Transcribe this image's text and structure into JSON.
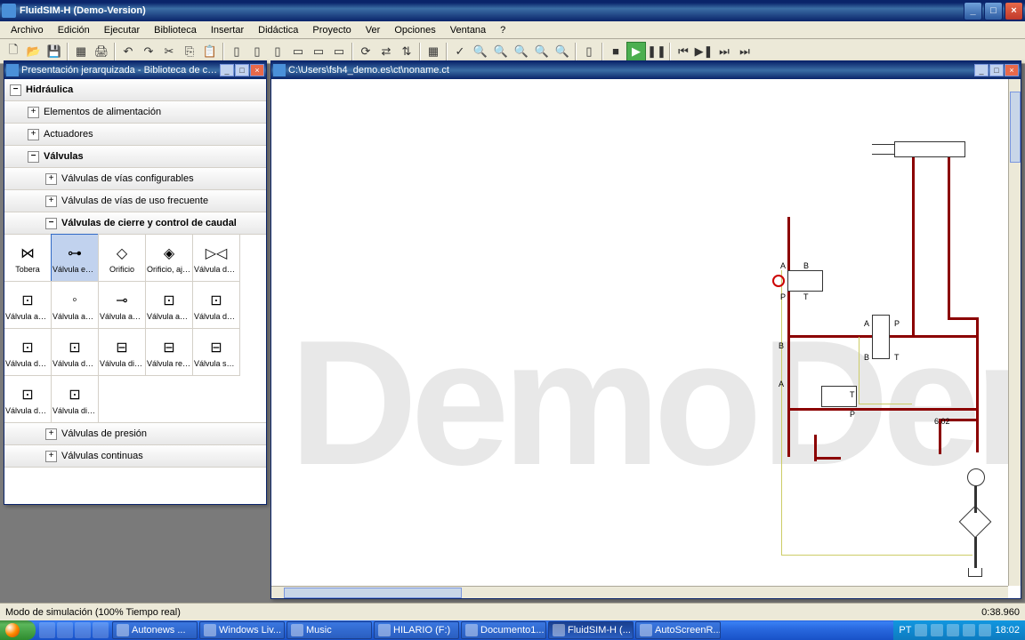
{
  "app": {
    "title": "FluidSIM-H (Demo-Version)"
  },
  "menu": [
    "Archivo",
    "Edición",
    "Ejecutar",
    "Biblioteca",
    "Insertar",
    "Didáctica",
    "Proyecto",
    "Ver",
    "Opciones",
    "Ventana",
    "?"
  ],
  "library": {
    "title": "Presentación jerarquizada - Biblioteca de co...",
    "root": "Hidráulica",
    "items": [
      {
        "label": "Elementos de alimentación",
        "level": 1,
        "exp": "+"
      },
      {
        "label": "Actuadores",
        "level": 1,
        "exp": "+"
      },
      {
        "label": "Válvulas",
        "level": 1,
        "exp": "−",
        "bold": true
      },
      {
        "label": "Válvulas de vías configurables",
        "level": 2,
        "exp": "+"
      },
      {
        "label": "Válvulas de vías de uso frecuente",
        "level": 2,
        "exp": "+"
      },
      {
        "label": "Válvulas de cierre y control de caudal",
        "level": 2,
        "exp": "−",
        "bold": true
      },
      {
        "label": "Válvulas de presión",
        "level": 2,
        "exp": "+",
        "after_grid": true
      },
      {
        "label": "Válvulas continuas",
        "level": 2,
        "exp": "+",
        "after_grid": true
      }
    ],
    "symbols_row1": [
      "Tobera",
      "Válvula estr...",
      "Orificio",
      "Orificio, aju...",
      "Válvula de ..."
    ],
    "symbols_row2": [
      "Válvula anti...",
      "Válvula anti...",
      "Válvula anti...",
      "Válvula anti...",
      "Válvula de r..."
    ],
    "symbols_row3": [
      "Válvula de r...",
      "Válvula de r...",
      "Válvula dire...",
      "Válvula reg...",
      "Válvula sele..."
    ],
    "symbols_row4": [
      "Válvula de ...",
      "Válvula dist..."
    ]
  },
  "circuit": {
    "title": "C:\\Users\\fsh4_demo.es\\ct\\noname.ct",
    "ports": {
      "a": "A",
      "b": "B",
      "p": "P",
      "t": "T"
    },
    "gauge": "6.02"
  },
  "status": {
    "left": "Modo de simulación (100% Tiempo real)",
    "right": "0:38.960"
  },
  "taskbar": {
    "items": [
      "Autonews ...",
      "Windows Liv...",
      "Music",
      "HILARIO (F:)",
      "Documento1...",
      "FluidSIM-H (...",
      "AutoScreenR..."
    ],
    "lang": "PT",
    "clock": "18:02"
  }
}
